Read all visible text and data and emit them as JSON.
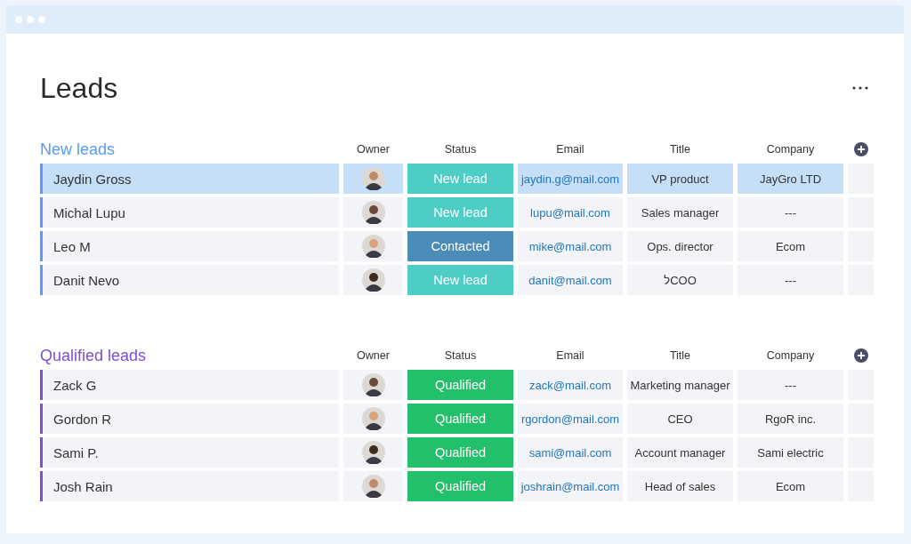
{
  "window": {
    "title": "Leads"
  },
  "groups": [
    {
      "title": "New leads",
      "color": "#579bfc",
      "columns": [
        "Owner",
        "Status",
        "Email",
        "Title",
        "Company"
      ],
      "rows": [
        {
          "name": "Jaydin Gross",
          "selected": true,
          "status": {
            "label": "New lead",
            "color": "#4eccc6"
          },
          "email": "jaydin.g@mail.com",
          "title": "VP product",
          "company": "JayGro LTD"
        },
        {
          "name": "Michal Lupu",
          "selected": false,
          "status": {
            "label": "New lead",
            "color": "#4eccc6"
          },
          "email": "lupu@mail.com",
          "title": "Sales manager",
          "company": "---"
        },
        {
          "name": "Leo M",
          "selected": false,
          "status": {
            "label": "Contacted",
            "color": "#4c8cb8"
          },
          "email": "mike@mail.com",
          "title": "Ops. director",
          "company": "Ecom"
        },
        {
          "name": "Danit Nevo",
          "selected": false,
          "status": {
            "label": "New lead",
            "color": "#4eccc6"
          },
          "email": "danit@mail.com",
          "title": "לCOO",
          "company": "---"
        }
      ]
    },
    {
      "title": "Qualified leads",
      "color": "#7e4fcf",
      "columns": [
        "Owner",
        "Status",
        "Email",
        "Title",
        "Company"
      ],
      "rows": [
        {
          "name": "Zack G",
          "selected": false,
          "status": {
            "label": "Qualified",
            "color": "#22c06b"
          },
          "email": "zack@mail.com",
          "title": "Marketing manager",
          "company": "---"
        },
        {
          "name": "Gordon R",
          "selected": false,
          "status": {
            "label": "Qualified",
            "color": "#22c06b"
          },
          "email": "rgordon@mail.com",
          "title": "CEO",
          "company": "RgoR inc."
        },
        {
          "name": "Sami P.",
          "selected": false,
          "status": {
            "label": "Qualified",
            "color": "#22c06b"
          },
          "email": "sami@mail.com",
          "title": "Account manager",
          "company": "Sami electric"
        },
        {
          "name": "Josh Rain",
          "selected": false,
          "status": {
            "label": "Qualified",
            "color": "#22c06b"
          },
          "email": "joshrain@mail.com",
          "title": "Head of sales",
          "company": "Ecom"
        }
      ]
    }
  ]
}
